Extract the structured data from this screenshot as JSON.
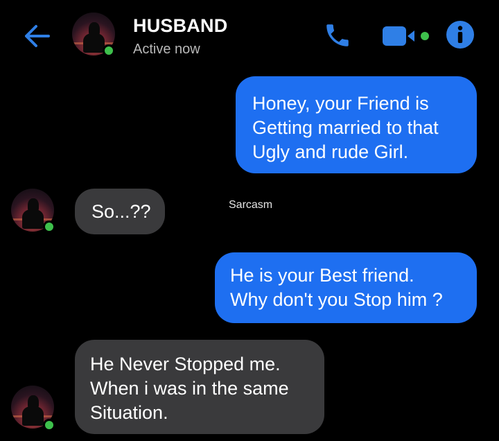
{
  "header": {
    "contact_name": "HUSBAND",
    "status": "Active now",
    "icons": [
      "back-arrow-icon",
      "phone-icon",
      "video-camera-icon",
      "info-icon"
    ],
    "accent_color": "#1e6ff1"
  },
  "messages": [
    {
      "from": "me",
      "lines": [
        "Honey, your Friend is",
        "Getting married to that",
        "Ugly and rude Girl."
      ]
    },
    {
      "from": "husband",
      "lines": [
        "So...??"
      ]
    },
    {
      "from": "me",
      "lines": [
        "He is your Best friend.",
        "Why don't you Stop him ?"
      ]
    },
    {
      "from": "husband",
      "lines": [
        "He Never Stopped me.",
        "When i was in the same",
        "Situation."
      ]
    }
  ],
  "annotation": "Sarcasm",
  "colors": {
    "outgoing_bubble": "#1e6ff1",
    "incoming_bubble": "#3a3a3c",
    "online": "#3ec04c",
    "background": "#000000"
  }
}
